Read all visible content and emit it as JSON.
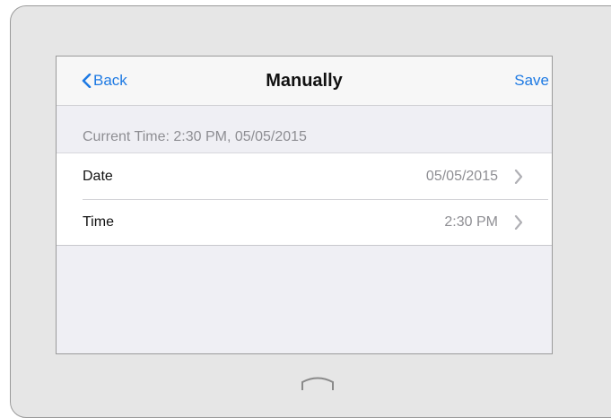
{
  "nav": {
    "back_label": "Back",
    "title": "Manually",
    "save_label": "Save"
  },
  "current_time_text": "Current Time: 2:30 PM, 05/05/2015",
  "rows": [
    {
      "label": "Date",
      "value": "05/05/2015",
      "icon": "chevron-right-icon"
    },
    {
      "label": "Time",
      "value": "2:30 PM",
      "icon": "chevron-right-icon"
    }
  ],
  "colors": {
    "accent": "#1e7ae3",
    "secondary_text": "#8e8e93",
    "screen_background": "#efeff4",
    "device_bezel": "#e6e6e6"
  },
  "icons": {
    "back": "chevron-left-icon",
    "home": "home-button-icon"
  }
}
